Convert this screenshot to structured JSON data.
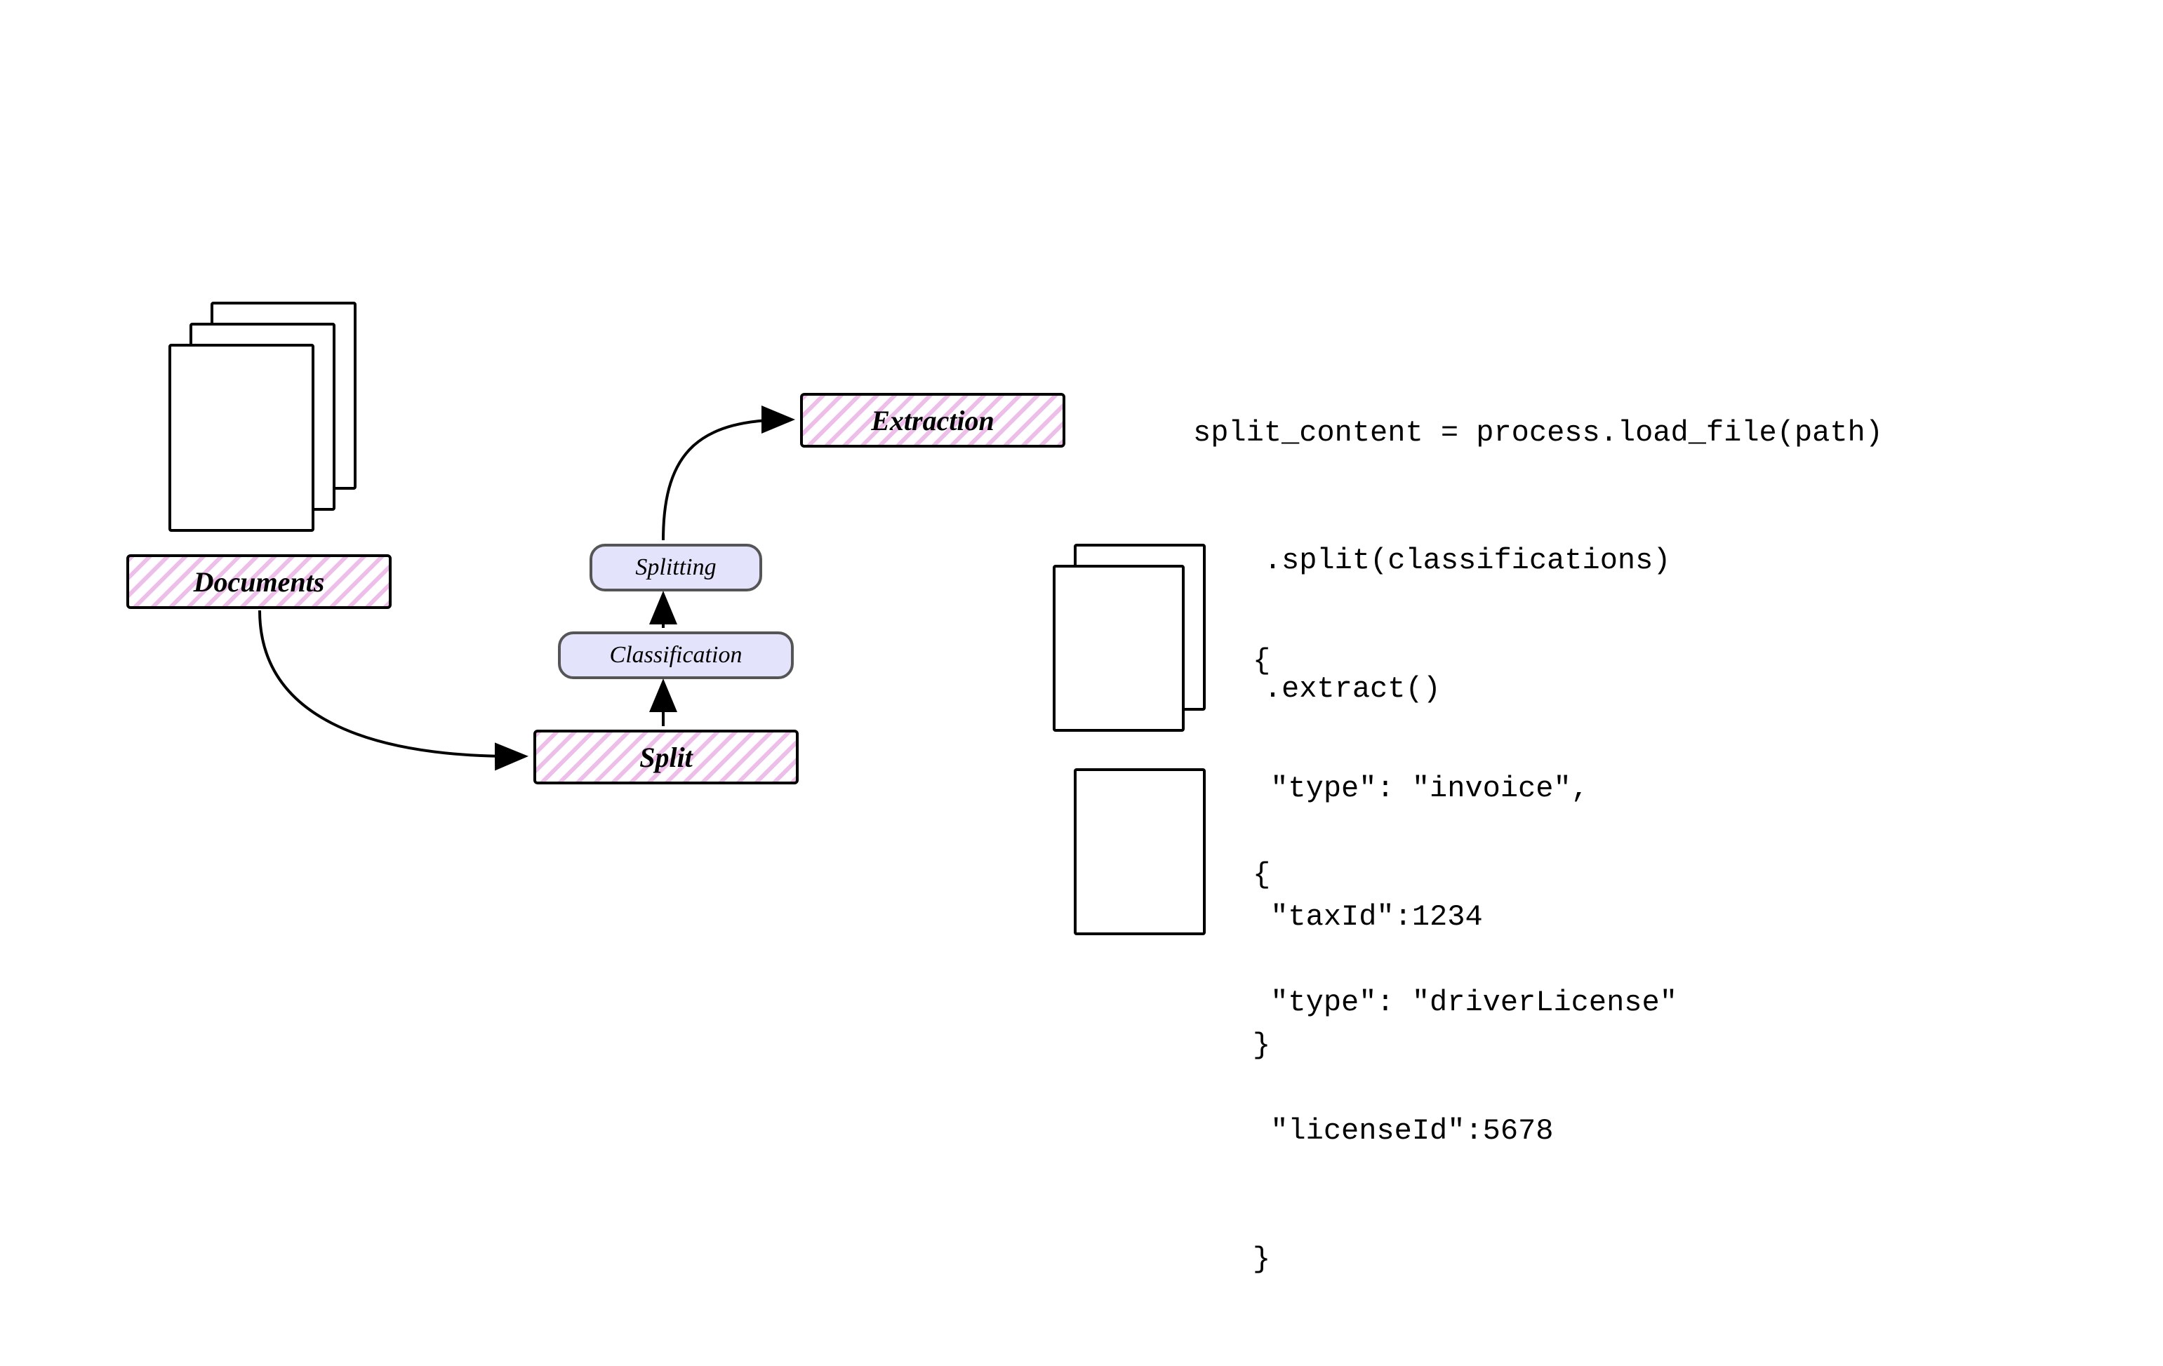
{
  "diagram": {
    "documents_label": "Documents",
    "split_label": "Split",
    "extraction_label": "Extraction",
    "classification_label": "Classification",
    "splitting_label": "Splitting"
  },
  "code": {
    "line1": "split_content = process.load_file(path)",
    "line2": "    .split(classifications)",
    "line3": "    .extract()",
    "json1_l1": "{",
    "json1_l2": " \"type\": \"invoice\",",
    "json1_l3": " \"taxId\":1234",
    "json1_l4": "}",
    "json2_l1": "{",
    "json2_l2": " \"type\": \"driverLicense\"",
    "json2_l3": " \"licenseId\":5678",
    "json2_l4": "}"
  }
}
